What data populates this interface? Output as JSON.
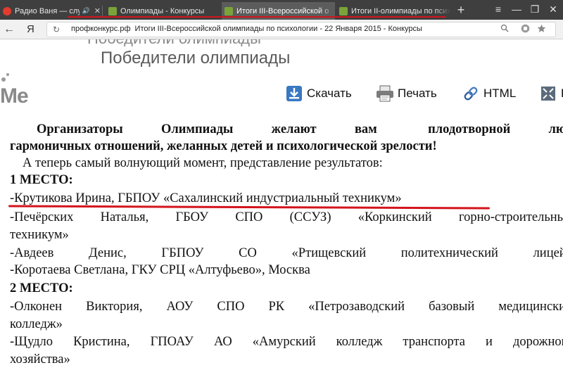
{
  "tabs": [
    {
      "label": "Радио Ваня — слушать",
      "favicon_color": "#e33b2e",
      "icons": [
        "🔊",
        "✕"
      ]
    },
    {
      "label": "Олимпиады - Конкурсы",
      "favicon_color": "#7aa33a"
    },
    {
      "label": "Итоги III-Всероссийской о",
      "favicon_color": "#7aa33a"
    },
    {
      "label": "Итоги II-олимпиады по психо",
      "favicon_color": "#7aa33a"
    }
  ],
  "new_tab": "+",
  "window_buttons": [
    "≡",
    "—",
    "❐",
    "✕"
  ],
  "nav": {
    "back": "←",
    "browser_logo": "Я",
    "reload": "↻",
    "url_domain": "профконкурс.рф",
    "url_title": "Итоги III-Всероссийской олимпиады по психологии - 22 Января 2015 - Конкурсы"
  },
  "page": {
    "site_title_ghost": "Победители олимпиады",
    "site_title": "Победители олимпиады",
    "logo_text": "Me",
    "actions": {
      "download": "Скачать",
      "print": "Печать",
      "html": "HTML",
      "more": "F"
    }
  },
  "document": {
    "greeting": {
      "line1_words": [
        "Организаторы",
        "Олимпиады",
        "желают",
        "вам",
        "плодотворной",
        "любви"
      ],
      "line2": "гармоничных отношений,  желанных детей и психологической  зрелости!"
    },
    "intro": "А теперь самый волнующий момент, представление результатов:",
    "places": [
      {
        "heading": "1 МЕСТО:",
        "winners": [
          "-Крутикова Ирина, ГБПОУ «Сахалинский индустриальный техникум»",
          [
            "-Печёрских",
            "Наталья,",
            "ГБОУ",
            "СПО",
            "(ССУЗ)",
            "«Коркинский",
            "горно-строительный"
          ],
          "техникум»",
          [
            "-Авдеев",
            "Денис,",
            "ГБПОУ",
            "СО",
            "«Ртищевский",
            "политехнический",
            "лицей»"
          ],
          "-Коротаева Светлана, ГКУ  СРЦ  «Алтуфьево», Москва"
        ]
      },
      {
        "heading": "2 МЕСТО:",
        "winners": [
          [
            "-Олконен",
            "Виктория,",
            "АОУ",
            "СПО",
            "РК",
            "«Петрозаводский",
            "базовый",
            "медицинский"
          ],
          "колледж»",
          [
            "-Щудло",
            "Кристина,",
            "ГПОАУ",
            "АО",
            "«Амурский",
            "колледж",
            "транспорта",
            "и",
            "дорожного"
          ],
          "хозяйства»"
        ]
      }
    ]
  }
}
